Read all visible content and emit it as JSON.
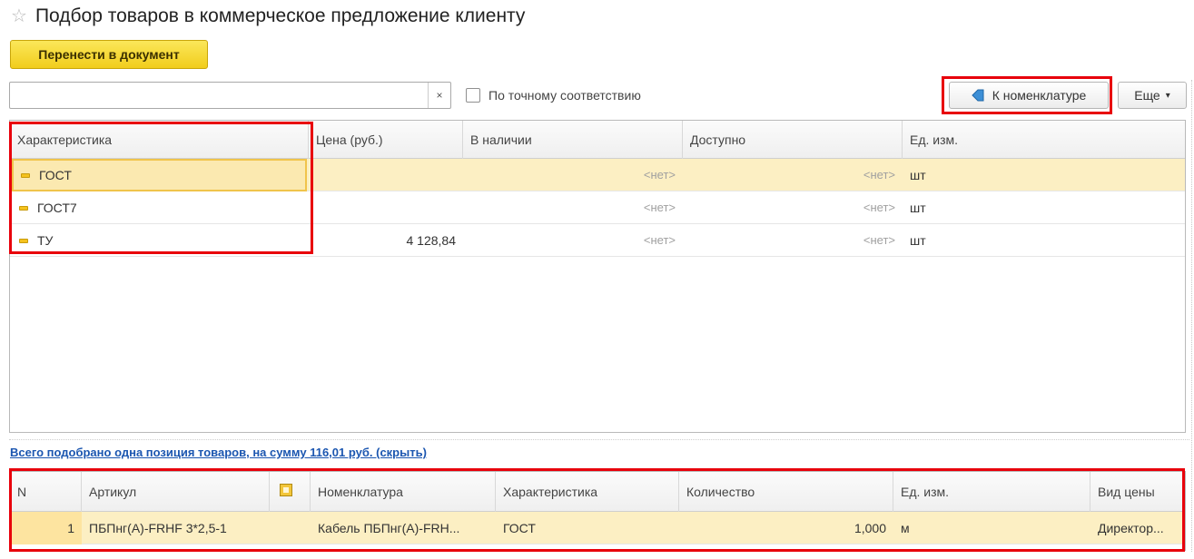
{
  "title": "Подбор товаров в коммерческое предложение клиенту",
  "toolbar": {
    "transfer_label": "Перенести в документ",
    "search_value": "",
    "search_clear_label": "×",
    "exact_match_label": "По точному соответствию",
    "to_nomenclature_label": "К номенклатуре",
    "more_label": "Еще"
  },
  "characteristics_table": {
    "columns": [
      "Характеристика",
      "Цена (руб.)",
      "В наличии",
      "Доступно",
      "Ед. изм."
    ],
    "rows": [
      {
        "characteristic": "ГОСТ",
        "price": "",
        "in_stock": "<нет>",
        "available": "<нет>",
        "unit": "шт"
      },
      {
        "characteristic": "ГОСТ7",
        "price": "",
        "in_stock": "<нет>",
        "available": "<нет>",
        "unit": "шт"
      },
      {
        "characteristic": "ТУ",
        "price": "4 128,84",
        "in_stock": "<нет>",
        "available": "<нет>",
        "unit": "шт"
      }
    ]
  },
  "summary_link": "Всего подобрано одна позиция товаров, на сумму 116,01 руб. (скрыть)",
  "selected_table": {
    "columns": [
      "N",
      "Артикул",
      "",
      "Номенклатура",
      "Характеристика",
      "Количество",
      "Ед. изм.",
      "Вид цены"
    ],
    "rows": [
      {
        "n": "1",
        "article": "ПБПнг(А)-FRHF 3*2,5-1",
        "nomenclature": "Кабель ПБПнг(А)-FRH...",
        "characteristic": "ГОСТ",
        "quantity": "1,000",
        "unit": "м",
        "price_type": "Директор..."
      }
    ]
  },
  "colors": {
    "accent_yellow": "#f5d22a",
    "highlight_red": "#e8000b",
    "selected_row": "#fcefc3",
    "link_blue": "#1b56b0"
  },
  "icons": {
    "favorite": "star-icon",
    "back": "back-arrow-icon",
    "characteristic": "dash-icon",
    "image_column": "image-icon"
  }
}
